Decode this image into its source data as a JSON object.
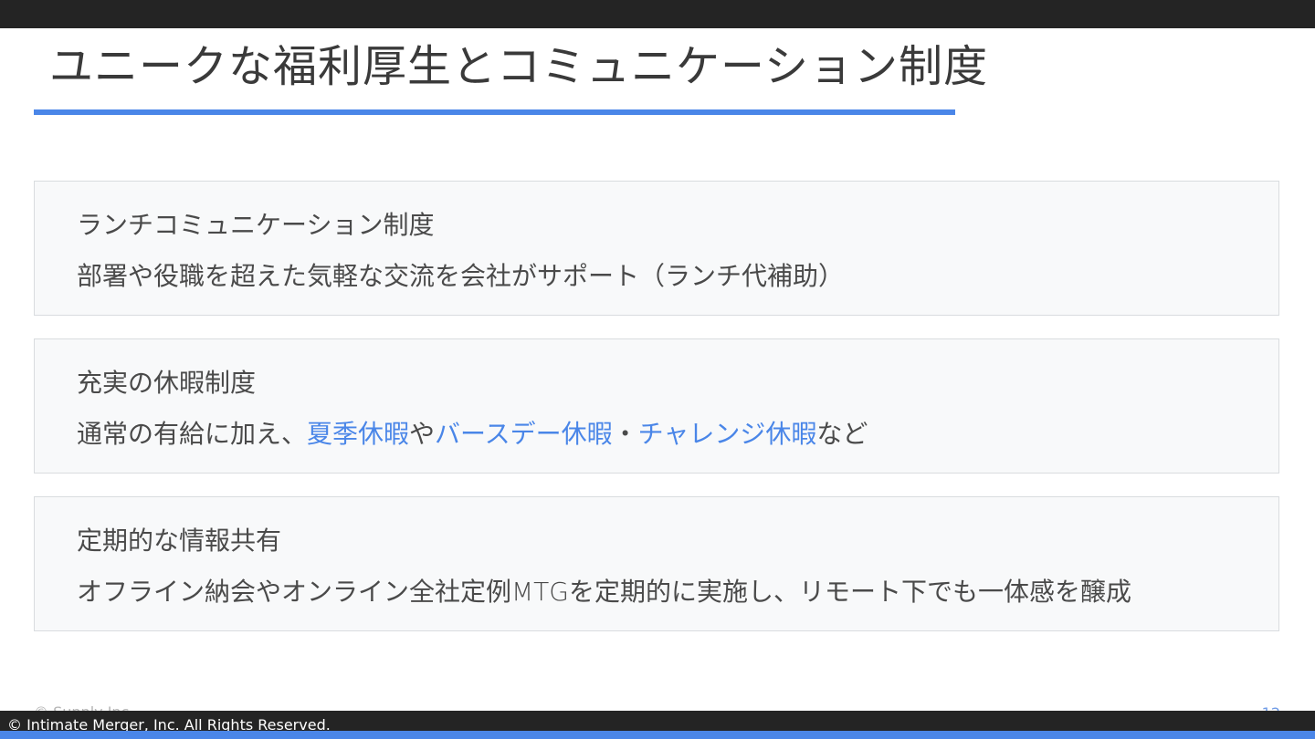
{
  "title": "ユニークな福利厚生とコミュニケーション制度",
  "cards": [
    {
      "title": "ランチコミュニケーション制度",
      "desc": "部署や役職を超えた気軽な交流を会社がサポート（ランチ代補助）"
    },
    {
      "title": "充実の休暇制度",
      "desc_parts": [
        "通常の有給に加え、",
        "夏季休暇",
        "や",
        "バースデー休暇",
        "・",
        "チャレンジ休暇",
        "など"
      ]
    },
    {
      "title": "定期的な情報共有",
      "desc": "オフライン納会やオンライン全社定例MTGを定期的に実施し、リモート下でも一体感を醸成"
    }
  ],
  "footer": {
    "ghost_copyright": "© Supply Inc.",
    "page_number": "12",
    "copyright": "© Intimate Merger, Inc. All Rights Reserved."
  },
  "colors": {
    "accent": "#4a86e8",
    "bar": "#242424",
    "card_bg": "#f8f9fa",
    "text": "#4a4a4a"
  }
}
